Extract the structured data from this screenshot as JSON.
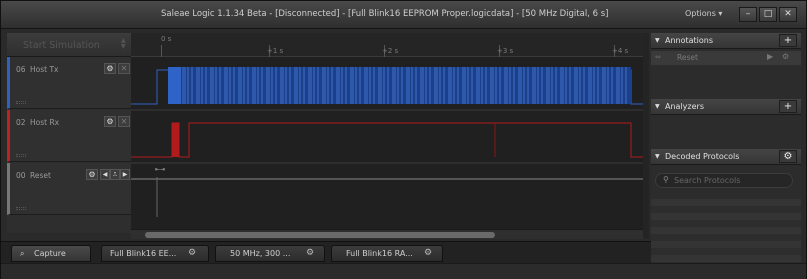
{
  "window": {
    "title": "Saleae Logic 1.1.34 Beta - [Disconnected] - [Full Blink16 EEPROM Proper.logicdata] - [50 MHz Digital, 6 s]",
    "options_label": "Options ▾",
    "minimize": "–",
    "maximize": "□",
    "close": "✕"
  },
  "left": {
    "start_simulation": "Start Simulation",
    "channels": [
      {
        "num": "06",
        "name": "Host Tx",
        "color": "#3060c0"
      },
      {
        "num": "02",
        "name": "Host Rx",
        "color": "#c02020"
      },
      {
        "num": "00",
        "name": "Reset",
        "color": "#888888"
      }
    ]
  },
  "ruler": {
    "zero": "0 s",
    "ticks": [
      "+1 s",
      "+2 s",
      "+3 s",
      "+4 s"
    ]
  },
  "right": {
    "annotations": "Annotations",
    "annotation_row": "Reset",
    "analyzers": "Analyzers",
    "decoded_protocols": "Decoded Protocols",
    "search_placeholder": "Search Protocols"
  },
  "tabs": {
    "capture": "Capture",
    "items": [
      "Full Blink16 EE...",
      "50 MHz, 300 ...",
      "Full Blink16 RA..."
    ]
  },
  "colors": {
    "tx": "#2f63c8",
    "rx": "#b01c1c"
  }
}
